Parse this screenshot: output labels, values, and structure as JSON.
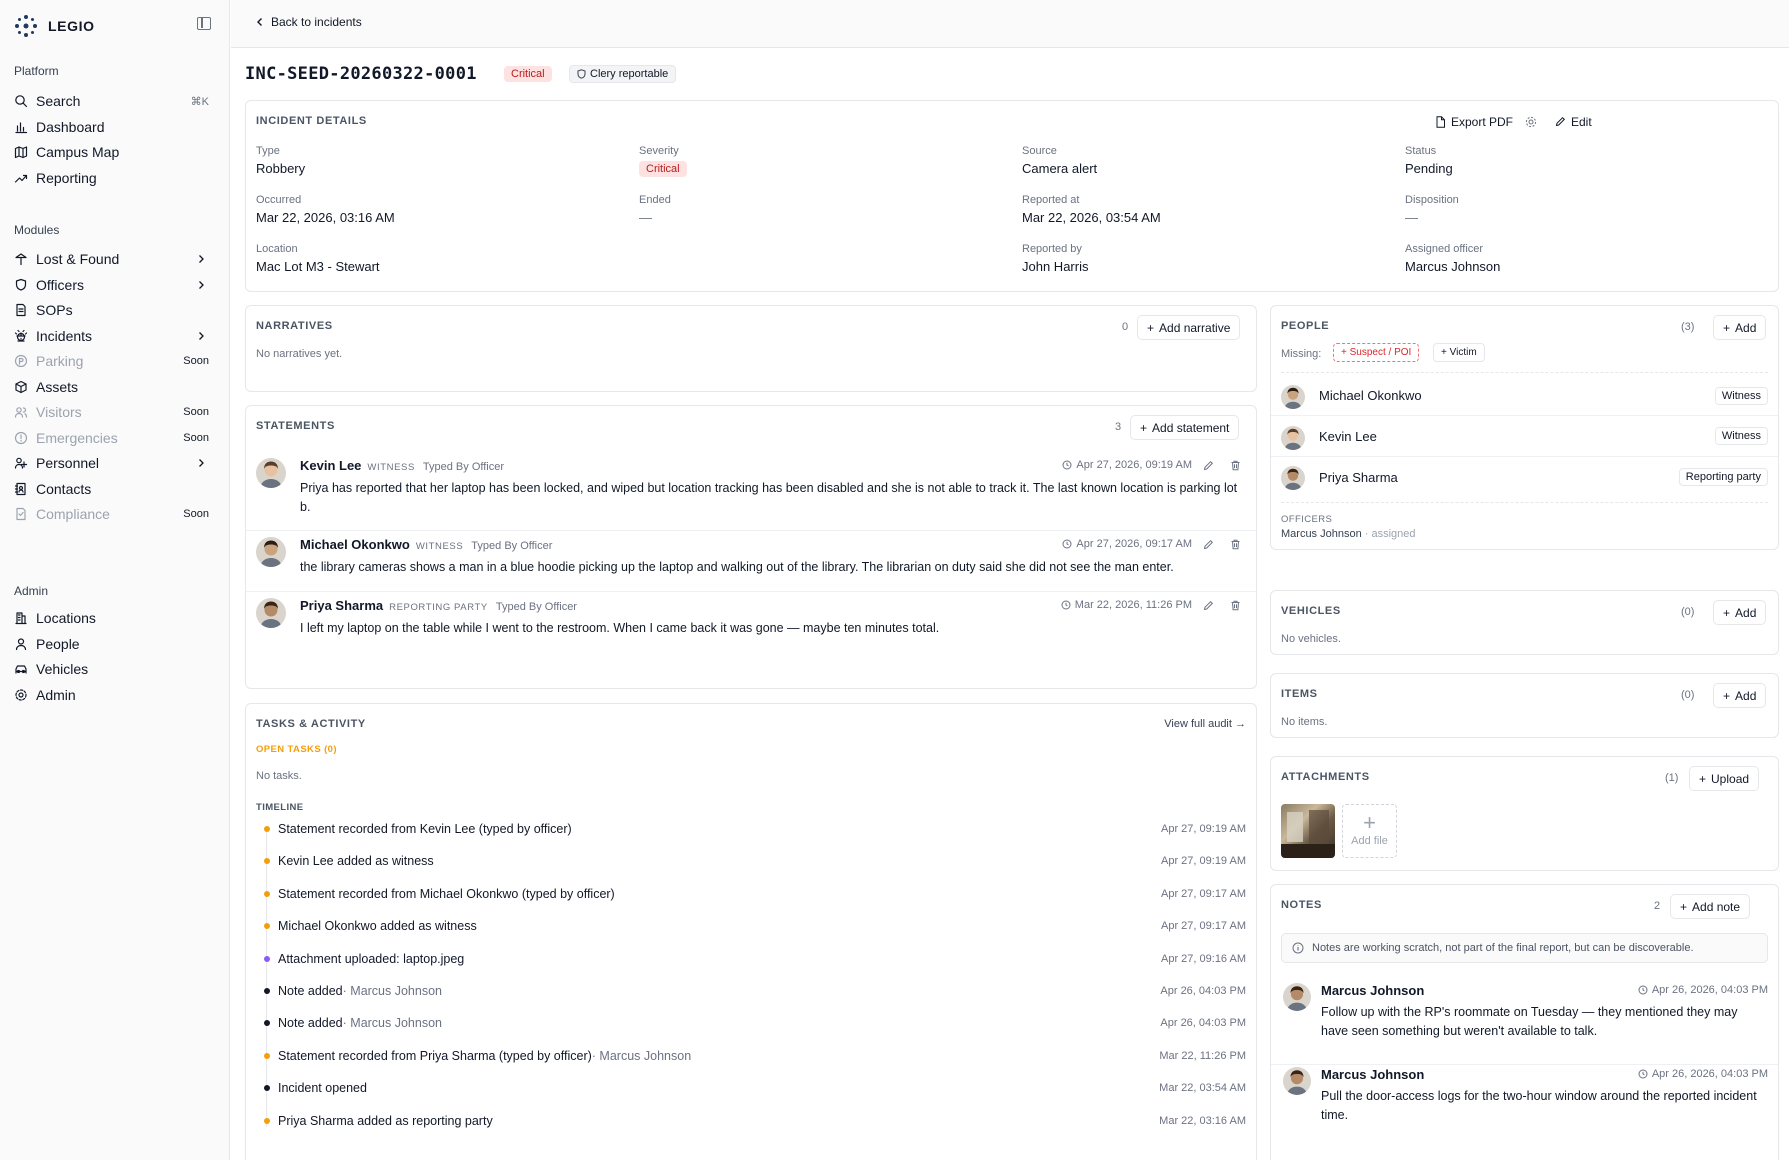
{
  "brand": {
    "name": "LEGIO"
  },
  "sidebar": {
    "platform_label": "Platform",
    "platform": [
      {
        "label": "Search",
        "right": "⌘K"
      },
      {
        "label": "Dashboard"
      },
      {
        "label": "Campus Map"
      },
      {
        "label": "Reporting"
      }
    ],
    "modules_label": "Modules",
    "modules": [
      {
        "label": "Lost & Found",
        "chev": true
      },
      {
        "label": "Officers",
        "chev": true
      },
      {
        "label": "SOPs"
      },
      {
        "label": "Incidents",
        "chev": true
      },
      {
        "label": "Parking",
        "right": "Soon",
        "dim": true
      },
      {
        "label": "Assets"
      },
      {
        "label": "Visitors",
        "right": "Soon",
        "dim": true
      },
      {
        "label": "Emergencies",
        "right": "Soon",
        "dim": true
      },
      {
        "label": "Personnel",
        "chev": true
      },
      {
        "label": "Contacts"
      },
      {
        "label": "Compliance",
        "right": "Soon",
        "dim": true
      }
    ],
    "admin_label": "Admin",
    "admin": [
      {
        "label": "Locations"
      },
      {
        "label": "People"
      },
      {
        "label": "Vehicles"
      },
      {
        "label": "Admin"
      }
    ]
  },
  "topbar": {
    "back": "Back to incidents"
  },
  "incident": {
    "id": "INC-SEED-20260322-0001",
    "severity_badge": "Critical",
    "clery": "Clery reportable"
  },
  "details": {
    "heading": "INCIDENT DETAILS",
    "export": "Export PDF",
    "edit": "Edit",
    "type_l": "Type",
    "type_v": "Robbery",
    "sev_l": "Severity",
    "sev_v": "Critical",
    "src_l": "Source",
    "src_v": "Camera alert",
    "status_l": "Status",
    "status_v": "Pending",
    "occ_l": "Occurred",
    "occ_v": "Mar 22, 2026, 03:16 AM",
    "end_l": "Ended",
    "end_v": "—",
    "rep_l": "Reported at",
    "rep_v": "Mar 22, 2026, 03:54 AM",
    "disp_l": "Disposition",
    "disp_v": "—",
    "loc_l": "Location",
    "loc_v": "Mac Lot M3 - Stewart",
    "by_l": "Reported by",
    "by_v": "John Harris",
    "asg_l": "Assigned officer",
    "asg_v": "Marcus Johnson"
  },
  "narratives": {
    "heading": "NARRATIVES",
    "count": "0",
    "add": "Add narrative",
    "empty": "No narratives yet."
  },
  "statements": {
    "heading": "STATEMENTS",
    "count": "3",
    "add": "Add statement",
    "items": [
      {
        "name": "Kevin Lee",
        "role": "WITNESS",
        "type": "Typed By Officer",
        "time": "Apr 27, 2026, 09:19 AM",
        "text": "Priya has reported that her laptop has been locked, and wiped but location tracking has been disabled and she is not able to track it. The last known location is parking lot b."
      },
      {
        "name": "Michael Okonkwo",
        "role": "WITNESS",
        "type": "Typed By Officer",
        "time": "Apr 27, 2026, 09:17 AM",
        "text": "the library cameras shows a man in a blue hoodie picking up the laptop and walking out of the library. The librarian on duty said she did not see the man enter."
      },
      {
        "name": "Priya Sharma",
        "role": "REPORTING PARTY",
        "type": "Typed By Officer",
        "time": "Mar 22, 2026, 11:26 PM",
        "text": "I left my laptop on the table while I went to the restroom. When I came back it was gone — maybe ten minutes total."
      }
    ]
  },
  "tasks": {
    "heading": "TASKS & ACTIVITY",
    "audit": "View full audit →",
    "open": "OPEN TASKS (0)",
    "none": "No tasks.",
    "timeline_l": "TIMELINE",
    "timeline": [
      {
        "text": "Statement recorded from Kevin Lee (typed by officer)",
        "who": "",
        "time": "Apr 27, 09:19 AM",
        "color": "#f59e0b"
      },
      {
        "text": "Kevin Lee added as witness",
        "who": "",
        "time": "Apr 27, 09:19 AM",
        "color": "#f59e0b"
      },
      {
        "text": "Statement recorded from Michael Okonkwo (typed by officer)",
        "who": "",
        "time": "Apr 27, 09:17 AM",
        "color": "#f59e0b"
      },
      {
        "text": "Michael Okonkwo added as witness",
        "who": "",
        "time": "Apr 27, 09:17 AM",
        "color": "#f59e0b"
      },
      {
        "text": "Attachment uploaded: laptop.jpeg",
        "who": "",
        "time": "Apr 27, 09:16 AM",
        "color": "#8b5cf6"
      },
      {
        "text": "Note added",
        "who": " · Marcus Johnson",
        "time": "Apr 26, 04:03 PM",
        "color": "#111827"
      },
      {
        "text": "Note added",
        "who": " · Marcus Johnson",
        "time": "Apr 26, 04:03 PM",
        "color": "#111827"
      },
      {
        "text": "Statement recorded from Priya Sharma (typed by officer)",
        "who": " · Marcus Johnson",
        "time": "Mar 22, 11:26 PM",
        "color": "#f59e0b"
      },
      {
        "text": "Incident opened",
        "who": "",
        "time": "Mar 22, 03:54 AM",
        "color": "#111827"
      },
      {
        "text": "Priya Sharma added as reporting party",
        "who": "",
        "time": "Mar 22, 03:16 AM",
        "color": "#f59e0b"
      }
    ]
  },
  "people": {
    "heading": "PEOPLE",
    "count": "(3)",
    "add": "Add",
    "missing": "Missing:",
    "m1": "+ Suspect / POI",
    "m2": "+ Victim",
    "items": [
      {
        "name": "Michael Okonkwo",
        "role": "Witness"
      },
      {
        "name": "Kevin Lee",
        "role": "Witness"
      },
      {
        "name": "Priya Sharma",
        "role": "Reporting party"
      }
    ],
    "officers_l": "OFFICERS",
    "officer": "Marcus Johnson",
    "officer_note": " · assigned"
  },
  "vehicles": {
    "heading": "VEHICLES",
    "count": "(0)",
    "add": "Add",
    "empty": "No vehicles."
  },
  "items": {
    "heading": "ITEMS",
    "count": "(0)",
    "add": "Add",
    "empty": "No items."
  },
  "attachments": {
    "heading": "ATTACHMENTS",
    "count": "(1)",
    "upload": "Upload",
    "add_file": "Add file"
  },
  "notes": {
    "heading": "NOTES",
    "count": "2",
    "add": "Add note",
    "info": "Notes are working scratch, not part of the final report, but can be discoverable.",
    "items": [
      {
        "name": "Marcus Johnson",
        "time": "Apr 26, 2026, 04:03 PM",
        "text": "Follow up with the RP's roommate on Tuesday — they mentioned they may have seen something but weren't available to talk."
      },
      {
        "name": "Marcus Johnson",
        "time": "Apr 26, 2026, 04:03 PM",
        "text": "Pull the door-access logs for the two-hour window around the reported incident time."
      }
    ]
  },
  "colors": {
    "accent": "#f59e0b",
    "critical_bg": "#fee2e2",
    "critical_fg": "#b91c1c",
    "purple": "#8b5cf6"
  }
}
